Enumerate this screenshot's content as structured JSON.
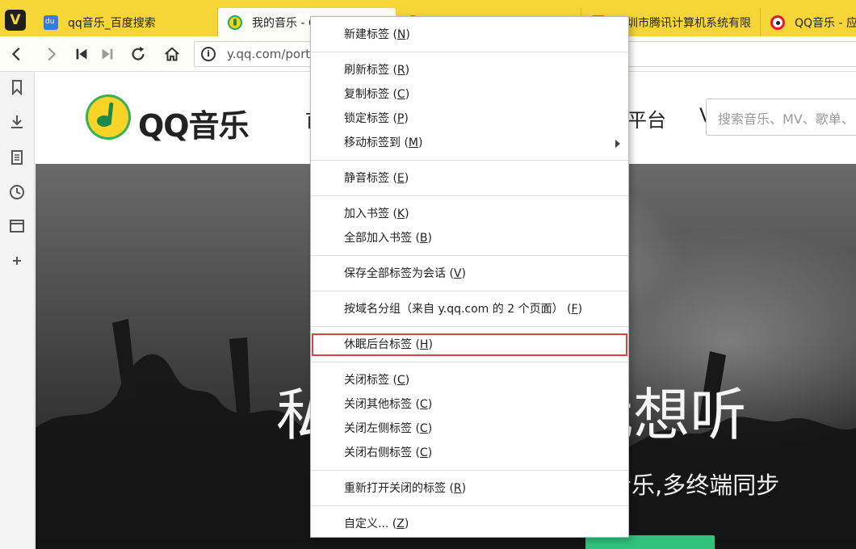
{
  "tabs": [
    {
      "title": "qq音乐_百度搜索",
      "icon": "baidu-icon"
    },
    {
      "title": "我的音乐 - Q",
      "icon": "qq-music-icon"
    },
    {
      "title": "",
      "icon": "qq-music-icon"
    },
    {
      "title": "深圳市腾讯计算机系统有限",
      "icon": "tencent-icon"
    },
    {
      "title": "QQ音乐 - 应",
      "icon": "weibo-icon"
    }
  ],
  "address": {
    "url": "y.qq.com/porta"
  },
  "site": {
    "logo": "QQ音乐",
    "nav_left_fragment": "首",
    "nav_right_fragment": "平台",
    "nav_far_fragment": "V",
    "search_placeholder": "搜索音乐、MV、歌单、"
  },
  "hero": {
    "title": "私人音乐,听我想听",
    "subtitle": "的音乐,多终端同步"
  },
  "context_menu": {
    "groups": [
      [
        {
          "label": "新建标签",
          "key": "N"
        }
      ],
      [
        {
          "label": "刷新标签",
          "key": "R"
        },
        {
          "label": "复制标签",
          "key": "C"
        },
        {
          "label": "锁定标签",
          "key": "P"
        },
        {
          "label": "移动标签到",
          "key": "M",
          "submenu": true
        }
      ],
      [
        {
          "label": "静音标签",
          "key": "E"
        }
      ],
      [
        {
          "label": "加入书签",
          "key": "K"
        },
        {
          "label": "全部加入书签",
          "key": "B"
        }
      ],
      [
        {
          "label": "保存全部标签为会话",
          "key": "V"
        }
      ],
      [
        {
          "label": "按域名分组（来自 y.qq.com 的 2 个页面）",
          "key": "F"
        }
      ],
      [
        {
          "label": "休眠后台标签",
          "key": "H",
          "highlighted": true
        }
      ],
      [
        {
          "label": "关闭标签",
          "key": "C"
        },
        {
          "label": "关闭其他标签",
          "key": "C"
        },
        {
          "label": "关闭左侧标签",
          "key": "C"
        },
        {
          "label": "关闭右侧标签",
          "key": "C"
        }
      ],
      [
        {
          "label": "重新打开关闭的标签",
          "key": "R"
        }
      ],
      [
        {
          "label": "自定义...",
          "key": "Z"
        }
      ]
    ]
  },
  "colors": {
    "tabbar": "#f6d637",
    "highlight_border": "#d94343",
    "qq_green": "#31c27c"
  }
}
